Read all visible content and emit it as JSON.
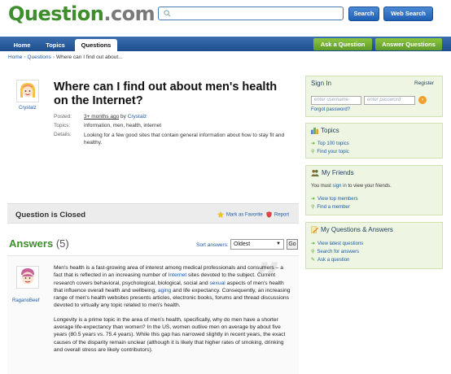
{
  "logo": {
    "q": "Question",
    "tld": ".com"
  },
  "search": {
    "placeholder": "",
    "button_label": "Search",
    "web_button_label": "Web Search"
  },
  "nav": {
    "tabs": [
      "Home",
      "Topics",
      "Questions"
    ],
    "ask_label": "Ask a Question",
    "answer_label": "Answer Questions"
  },
  "breadcrumb": {
    "home": "Home",
    "section": "Questions",
    "current": "Where can I find out about..."
  },
  "question": {
    "asker": "Crystalz",
    "title": "Where can I find out about men's health on the Internet?",
    "posted_label": "Posted:",
    "posted_value": "3+ months ago",
    "posted_by": "by",
    "posted_user": "Crystalz",
    "topics_label": "Topics:",
    "topics_value": "information, men, health, internet",
    "details_label": "Details:",
    "details_value": "Looking for a few good sites that contain general information about how to stay fit and healthy."
  },
  "closed": {
    "title": "Question is Closed",
    "favorite": "Mark as Favorite",
    "report": "Report"
  },
  "answers": {
    "heading": "Answers",
    "count": "(5)",
    "sort_label": "Sort answers:",
    "sort_value": "Oldest",
    "go_label": "Go"
  },
  "answer1": {
    "author": "RaganoBeef",
    "p1_a": "Men's health is a fast-growing area of interest among medical professionals and consumers – a fact that is reflected in an increasing number of ",
    "p1_link1": "Internet",
    "p1_b": " sites devoted to the subject. Current research covers behavioral, psychological, biological, social and ",
    "p1_link2": "sexual",
    "p1_c": " aspects of men's health that influence overall health and wellbeing, ",
    "p1_link3": "aging",
    "p1_d": " and life expectancy. Consequently, an increasing range of men's health websites presents articles, electronic books, forums and thread discussions devoted to virtually any topic related to men's health.",
    "p2": "Longevity is a prime topic in the area of men's health, specifically, why do men have a shorter average life-expectancy than women? In the US, women outlive men on average by about five years (80.5 years vs. 75.4 years). While this gap has narrowed slightly in recent years, the exact causes of the disparity remain unclear (although it is likely that higher rates of smoking, drinking and overall stress are likely contributors)."
  },
  "sidebar": {
    "signin": {
      "title": "Sign In",
      "register": "Register",
      "username_ph": "enter username",
      "password_ph": "enter password",
      "forgot": "Forgot password?"
    },
    "topics": {
      "title": "Topics",
      "links": [
        "Top 100 topics",
        "Find your topic"
      ]
    },
    "friends": {
      "title": "My Friends",
      "note_a": "You must ",
      "note_link": "sign in",
      "note_b": " to view your friends.",
      "links": [
        "View top members",
        "Find a member"
      ]
    },
    "qa": {
      "title": "My Questions & Answers",
      "links": [
        "View latest questions",
        "Search for answers",
        "Ask a question"
      ]
    }
  },
  "colors": {
    "brand_green": "#3f8e2e",
    "nav_blue": "#1d4d8c",
    "link": "#1a5aa8",
    "sidebar_bg": "#eef5e2"
  }
}
